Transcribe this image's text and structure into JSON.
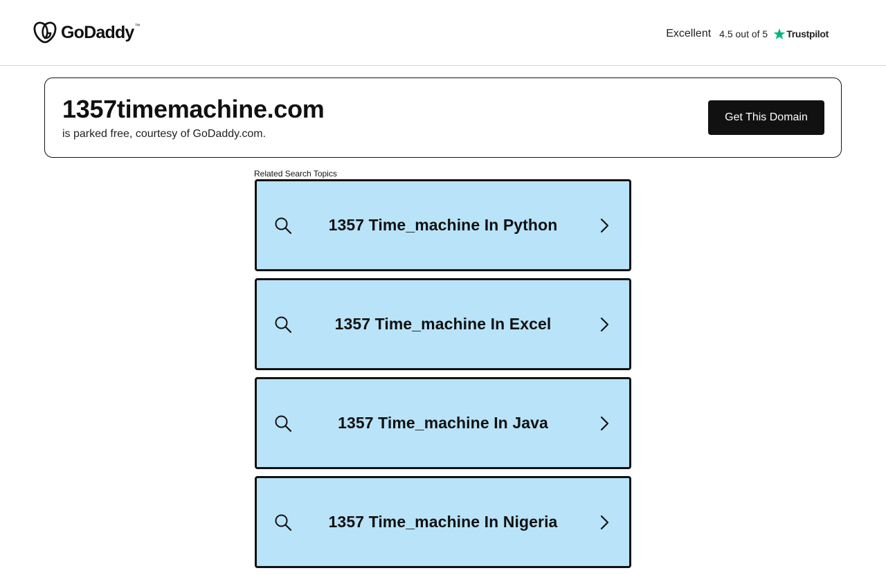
{
  "header": {
    "logo_text": "GoDaddy",
    "logo_tm": "™",
    "rating_word": "Excellent",
    "rating_score": "4.5 out of 5",
    "trustpilot_label": "Trustpilot",
    "trustpilot_star_color": "#00b67a"
  },
  "domain_card": {
    "domain": "1357timemachine.com",
    "subtitle": "is parked free, courtesy of GoDaddy.com.",
    "cta_label": "Get This Domain"
  },
  "related": {
    "heading": "Related Search Topics",
    "topics": [
      {
        "label": "1357 Time_machine In Python"
      },
      {
        "label": "1357 Time_machine In Excel"
      },
      {
        "label": "1357 Time_machine In Java"
      },
      {
        "label": "1357 Time_machine In Nigeria"
      }
    ],
    "card_color": "#b9e3f8"
  }
}
